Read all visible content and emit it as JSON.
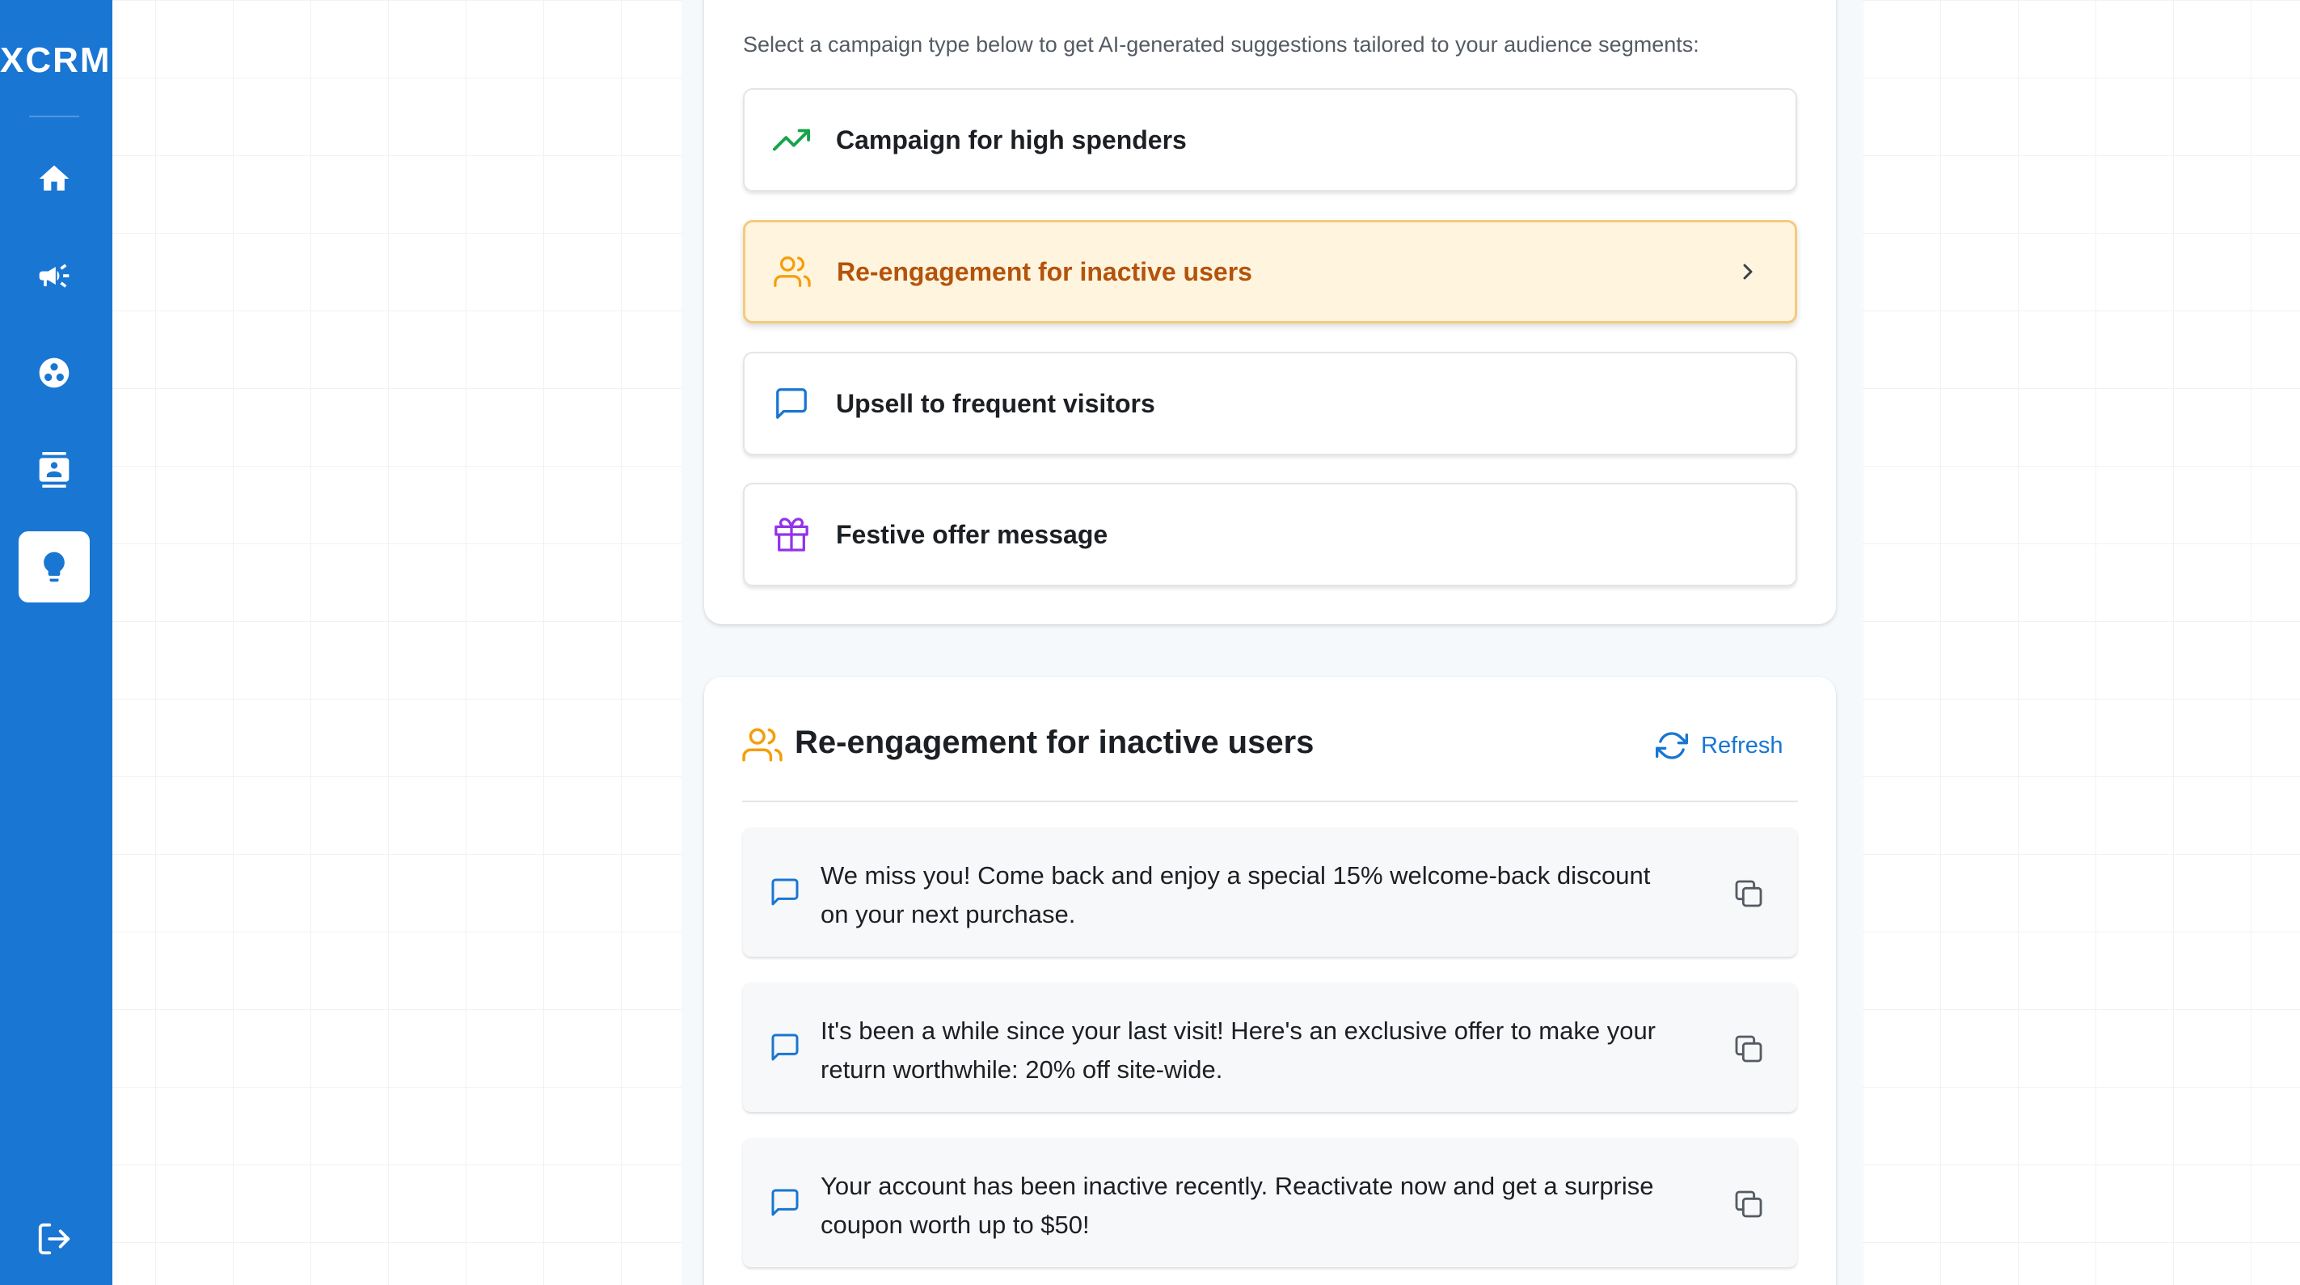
{
  "app": {
    "logo": "XCRM"
  },
  "sidebar": {
    "items": [
      {
        "icon": "home-icon",
        "active": false
      },
      {
        "icon": "megaphone-icon",
        "active": false
      },
      {
        "icon": "segments-icon",
        "active": false
      },
      {
        "icon": "contacts-icon",
        "active": false
      },
      {
        "icon": "lightbulb-icon",
        "active": true
      }
    ],
    "logout_icon": "logout-icon"
  },
  "intro": "Select a campaign type below to get AI-generated suggestions tailored to your audience segments:",
  "campaign_types": [
    {
      "label": "Campaign for high spenders",
      "icon": "trending-up-icon",
      "color": "#16a34a"
    },
    {
      "label": "Re-engagement for inactive users",
      "icon": "users-icon",
      "color": "#f59e0b",
      "selected": true
    },
    {
      "label": "Upsell to frequent visitors",
      "icon": "message-icon",
      "color": "#1976d2"
    },
    {
      "label": "Festive offer message",
      "icon": "gift-icon",
      "color": "#9333ea"
    }
  ],
  "suggestions_section": {
    "title": "Re-engagement for inactive users",
    "refresh_label": "Refresh",
    "items": [
      "We miss you! Come back and enjoy a special 15% welcome-back discount on your next purchase.",
      "It's been a while since your last visit! Here's an exclusive offer to make your return worthwhile: 20% off site-wide.",
      "Your account has been inactive recently. Reactivate now and get a surprise coupon worth up to $50!"
    ]
  },
  "colors": {
    "primary": "#1976d2",
    "selected_bg": "#fff4de",
    "selected_border": "#f3cb7c",
    "selected_text": "#b4530b"
  }
}
